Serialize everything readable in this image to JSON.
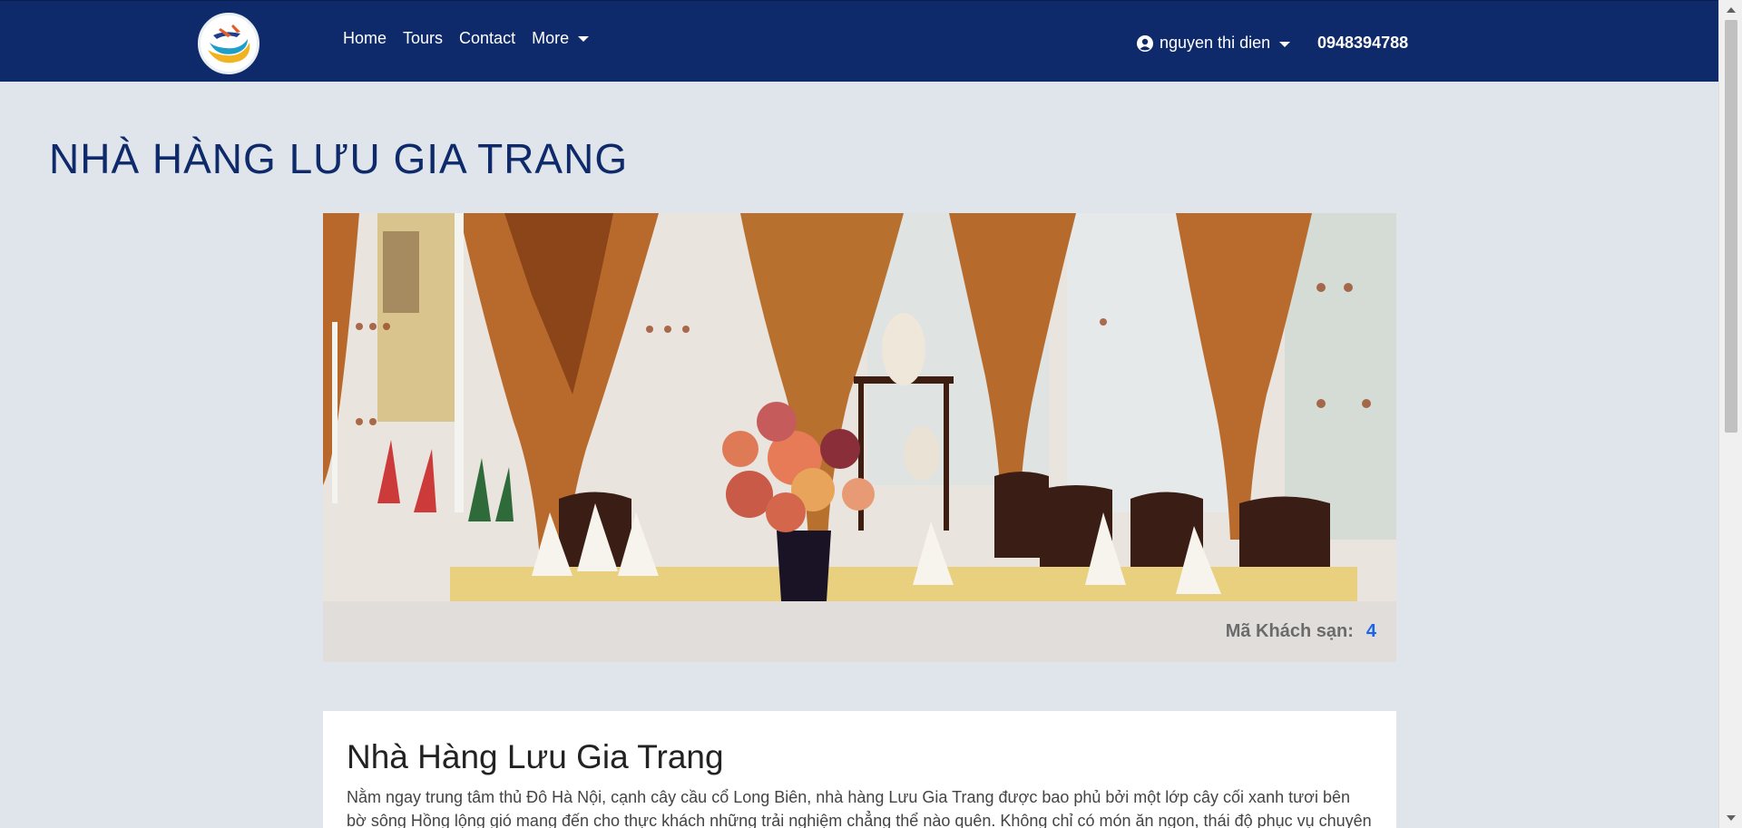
{
  "nav": {
    "links": [
      "Home",
      "Tours",
      "Contact",
      "More"
    ],
    "user_name": "nguyen thi dien",
    "phone": "0948394788"
  },
  "page": {
    "title": "NHÀ HÀNG LƯU GIA TRANG"
  },
  "meta": {
    "code_label": "Mã Khách sạn:",
    "code_value": "4"
  },
  "content": {
    "heading": "Nhà Hàng Lưu Gia Trang",
    "text": "Nằm ngay trung tâm thủ Đô Hà Nội, cạnh cây cầu cổ Long Biên, nhà hàng Lưu Gia Trang được bao phủ bởi một lớp cây cối xanh tươi bên bờ sông Hồng lộng gió mang đến cho thực khách những trải nghiệm chẳng thể nào quên. Không chỉ có món ăn ngon, thái độ phục vụ chuyên"
  },
  "colors": {
    "navbar": "#0e2a6b",
    "title": "#0e2a6b",
    "background": "#dfe5ea",
    "link_value": "#1a64e8"
  },
  "icons": {
    "logo": "travel-logo-icon",
    "user": "user-circle-icon",
    "caret": "caret-down-icon"
  }
}
